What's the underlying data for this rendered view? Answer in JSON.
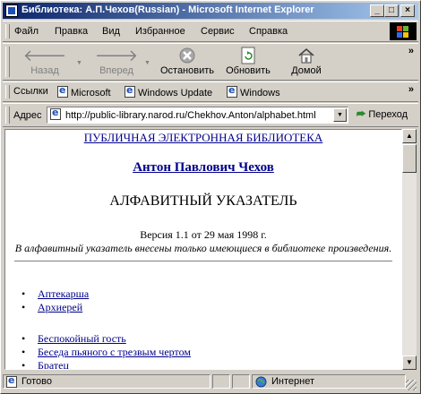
{
  "window": {
    "title": "Библиотека: А.П.Чехов(Russian) - Microsoft Internet Explorer"
  },
  "menu": [
    "Файл",
    "Правка",
    "Вид",
    "Избранное",
    "Сервис",
    "Справка"
  ],
  "toolbar": {
    "back": "Назад",
    "forward": "Вперед",
    "stop": "Остановить",
    "refresh": "Обновить",
    "home": "Домой"
  },
  "links": {
    "label": "Ссылки",
    "items": [
      "Microsoft",
      "Windows Update",
      "Windows"
    ]
  },
  "address": {
    "label": "Адрес",
    "url": "http://public-library.narod.ru/Chekhov.Anton/alphabet.html",
    "go": "Переход"
  },
  "page": {
    "library_link": "ПУБЛИЧНАЯ ЭЛЕКТРОННАЯ БИБЛИОТЕКА",
    "author_link": "Антон Павлович Чехов",
    "heading": "АЛФАВИТНЫЙ УКАЗАТЕЛЬ",
    "version": "Версия 1.1 от 29 мая 1998 г.",
    "note": "В алфавитный указатель внесены только имеющиеся в библиотеке произведения.",
    "group_a": [
      "Аптекарша",
      "Архиерей"
    ],
    "group_b": [
      "Беспокойный гость",
      "Беседа пьяного с трезвым чертом",
      "Братец"
    ]
  },
  "status": {
    "text": "Готово",
    "zone": "Интернет"
  },
  "colors": {
    "title_start": "#0a246a",
    "title_end": "#a6caf0",
    "link": "#00008b"
  }
}
